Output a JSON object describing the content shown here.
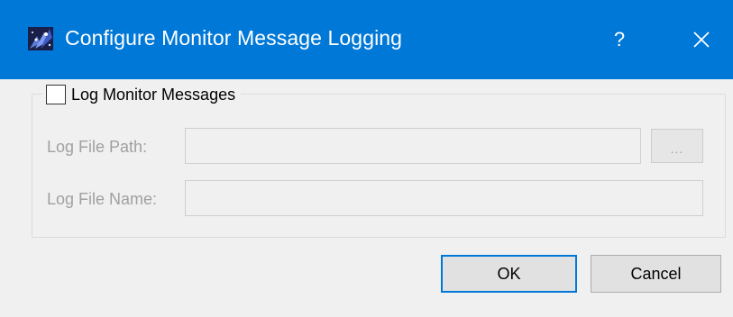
{
  "window": {
    "title": "Configure Monitor Message Logging",
    "help_label": "?",
    "icons": {
      "app": "app-sparkle-icon",
      "close": "close-icon"
    }
  },
  "logging": {
    "checkbox_label": "Log Monitor Messages",
    "checked": false
  },
  "fields": {
    "path_label": "Log File Path:",
    "path_value": "",
    "browse_label": "...",
    "name_label": "Log File Name:",
    "name_value": ""
  },
  "buttons": {
    "ok_label": "OK",
    "cancel_label": "Cancel"
  },
  "colors": {
    "titlebar": "#0078d7",
    "body": "#f0f0f0",
    "disabled_text": "#a0a0a0",
    "default_button_border": "#0078d7"
  }
}
